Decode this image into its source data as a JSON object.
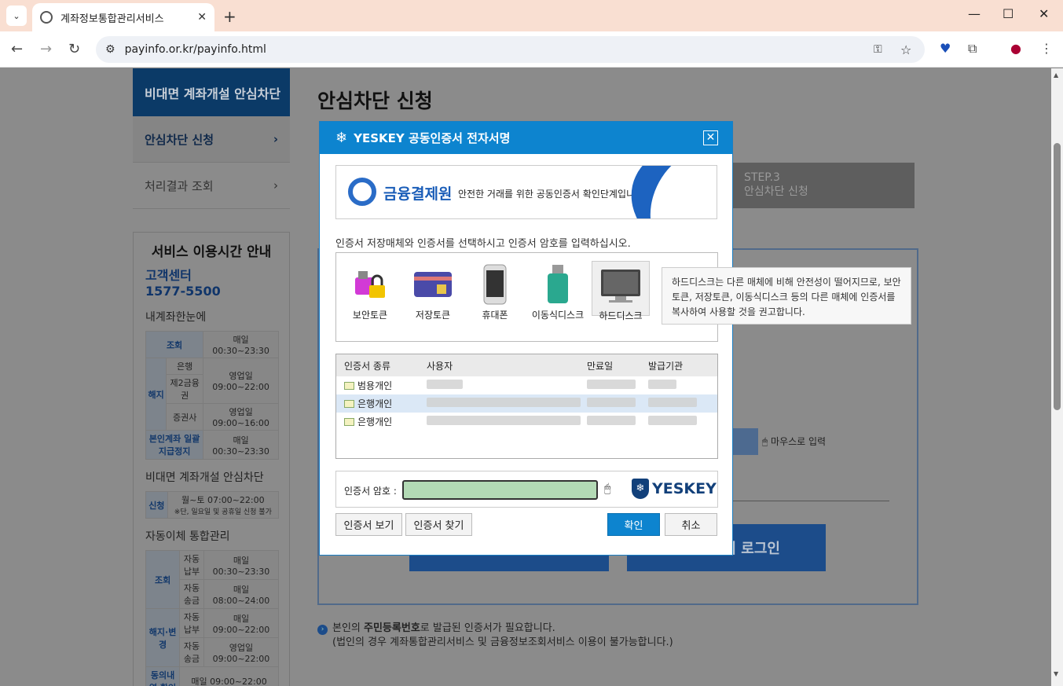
{
  "browser": {
    "tab_title": "계좌정보통합관리서비스",
    "url": "payinfo.or.kr/payinfo.html",
    "new_tab": "+",
    "tab_close": "✕",
    "minimize": "—",
    "maximize": "☐",
    "close": "✕"
  },
  "leftnav": {
    "header": "비대면 계좌개설 안심차단",
    "items": [
      {
        "label": "안심차단 신청",
        "arrow": "›"
      },
      {
        "label": "처리결과 조회",
        "arrow": "›"
      }
    ]
  },
  "service": {
    "title": "서비스 이용시간 안내",
    "center_label": "고객센터",
    "center_phone": "1577-5500",
    "sec1": "내계좌한눈에",
    "t1": {
      "r1": [
        "조회",
        "매일 00:30~23:30"
      ],
      "group": "해지",
      "r2": [
        "은행",
        "영업일 09:00~22:00"
      ],
      "r3": [
        "제2금융권"
      ],
      "r4": [
        "증권사",
        "영업일 09:00~16:00"
      ],
      "r5": [
        "본인계좌 일괄지급정지",
        "매일 00:30~23:30"
      ]
    },
    "sec2": "비대면 계좌개설 안심차단",
    "t2": {
      "r1": [
        "신청",
        "월~토 07:00~22:00",
        "※단, 일요일 및 공휴일 신청 불가"
      ]
    },
    "sec3": "자동이체 통합관리",
    "t3": {
      "g1": "조회",
      "r1": [
        "자동납부",
        "매일 00:30~23:30"
      ],
      "r2": [
        "자동송금",
        "매일 08:00~24:00"
      ],
      "g2": "해지·변경",
      "r3": [
        "자동납부",
        "매일 09:00~22:00"
      ],
      "r4": [
        "자동송금",
        "영업일 09:00~22:00"
      ],
      "r5": [
        "동의내역 확인",
        "매일 09:00~22:00"
      ]
    }
  },
  "main": {
    "title": "안심차단 신청",
    "step3_num": "STEP.3",
    "step3_label": "안심차단 신청",
    "mouse_input": "마우스로 입력",
    "login_button": "서 로그인",
    "notice_pre": "본인의 ",
    "notice_bold": "주민등록번호",
    "notice_post": "로 발급된 인증서가 필요합니다.",
    "notice_line2": "(법인의 경우 계좌통합관리서비스 및 금융정보조회서비스 이용이 불가능합니다.)"
  },
  "dialog": {
    "title": "YESKEY 공동인증서 전자서명",
    "close": "✕",
    "banner_name": "금융결제원",
    "banner_desc": "안전한 거래를 위한 공동인증서 확인단계입니다.",
    "instruction": "인증서 저장매체와 인증서를 선택하시고 인증서 암호를 입력하십시오.",
    "media": [
      {
        "label": "보안토큰",
        "icon": "security-token-icon"
      },
      {
        "label": "저장토큰",
        "icon": "storage-token-icon"
      },
      {
        "label": "휴대폰",
        "icon": "phone-icon"
      },
      {
        "label": "이동식디스크",
        "icon": "usb-drive-icon"
      },
      {
        "label": "하드디스크",
        "icon": "hard-disk-icon"
      }
    ],
    "tooltip": "하드디스크는 다른 매체에 비해 안전성이 떨어지므로, 보안토큰, 저장토큰, 이동식디스크 등의 다른 매체에 인증서를 복사하여 사용할 것을 권고합니다.",
    "columns": [
      "인증서 종류",
      "사용자",
      "만료일",
      "발급기관"
    ],
    "certs": [
      {
        "type": "범용개인"
      },
      {
        "type": "은행개인"
      },
      {
        "type": "은행개인"
      }
    ],
    "password_label": "인증서 암호 :",
    "brand": "YESKEY",
    "btn_view": "인증서 보기",
    "btn_find": "인증서 찾기",
    "btn_ok": "확인",
    "btn_cancel": "취소"
  }
}
